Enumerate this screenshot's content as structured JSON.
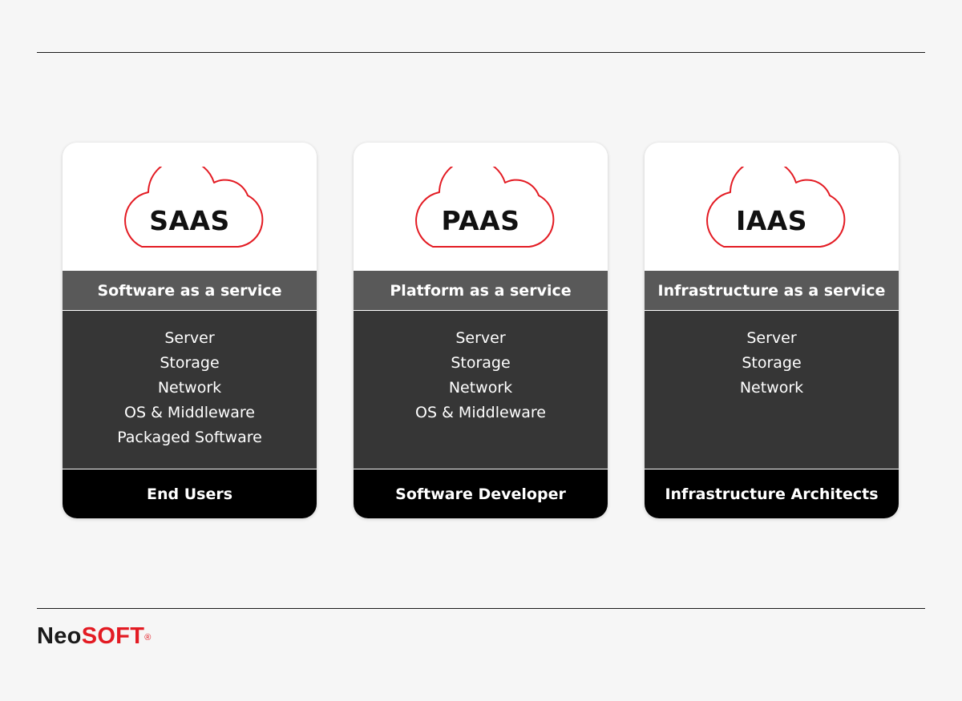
{
  "colors": {
    "background": "#f6f6f6",
    "cloud_outline": "#e31b23",
    "title_band": "#595959",
    "list_band": "#363636",
    "footer_band": "#000000",
    "brand_dark": "#1a1a1a",
    "brand_red": "#e31b23"
  },
  "cards": [
    {
      "acronym": "SAAS",
      "title": "Software as a service",
      "items": [
        "Server",
        "Storage",
        "Network",
        "OS & Middleware",
        "Packaged Software"
      ],
      "audience": "End Users"
    },
    {
      "acronym": "PAAS",
      "title": "Platform as a service",
      "items": [
        "Server",
        "Storage",
        "Network",
        "OS & Middleware"
      ],
      "audience": "Software Developer"
    },
    {
      "acronym": "IAAS",
      "title": "Infrastructure as a service",
      "items": [
        "Server",
        "Storage",
        "Network"
      ],
      "audience": "Infrastructure Architects"
    }
  ],
  "brand": {
    "part1": "Neo",
    "part2": "SOFT",
    "mark": "®"
  }
}
